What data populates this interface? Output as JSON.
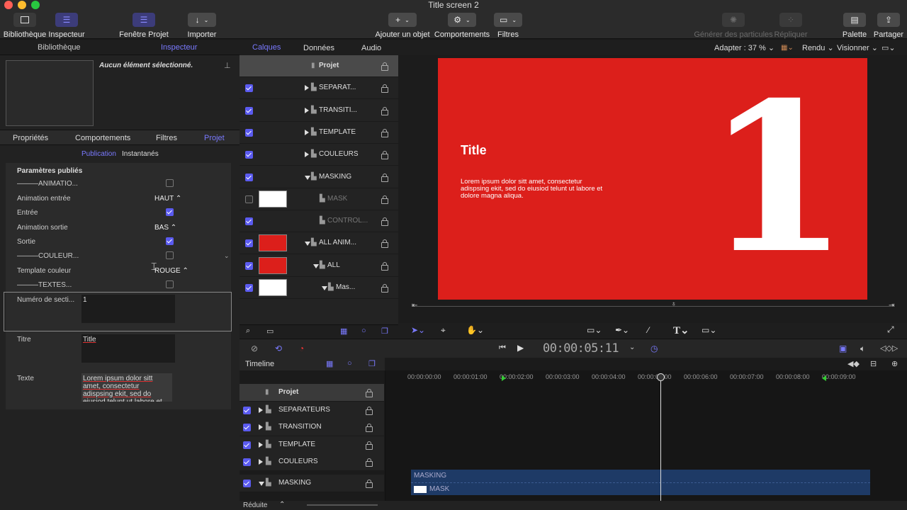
{
  "window": {
    "title": "Title screen 2"
  },
  "toolbar": {
    "library": "Bibliothèque",
    "inspector": "Inspecteur",
    "project_pane": "Fenêtre Projet",
    "import": "Importer",
    "add_object": "Ajouter un objet",
    "behaviors": "Comportements",
    "filters": "Filtres",
    "particles": "Générer des particules",
    "replicate": "Répliquer",
    "palette": "Palette",
    "share": "Partager"
  },
  "left_tabs": {
    "library": "Bibliothèque",
    "inspector": "Inspecteur"
  },
  "preview": {
    "none_selected": "Aucun élément sélectionné."
  },
  "inspector_tabs": [
    "Propriétés",
    "Comportements",
    "Filtres",
    "Projet"
  ],
  "subtabs": {
    "publication": "Publication",
    "snapshots": "Instantanés"
  },
  "params": {
    "header": "Paramètres publiés",
    "rows": [
      {
        "label": "———ANIMATIO...",
        "value": "",
        "checked": false
      },
      {
        "label": "Animation entrée",
        "value": "HAUT ⌃",
        "checked": null
      },
      {
        "label": "Entrée",
        "value": "",
        "checked": true
      },
      {
        "label": "Animation sortie",
        "value": "BAS ⌃",
        "checked": null
      },
      {
        "label": "Sortie",
        "value": "",
        "checked": true
      },
      {
        "label": "———COULEUR...",
        "value": "",
        "checked": false
      },
      {
        "label": "Template couleur",
        "value": "ROUGE ⌃",
        "checked": null
      },
      {
        "label": "———TEXTES...",
        "value": "",
        "checked": false
      }
    ],
    "section_number_label": "Numéro de secti...",
    "section_number_value": "1",
    "title_label": "Titre",
    "title_value": "Title",
    "text_label": "Texte",
    "text_value": "Lorem ipsum dolor sitt amet, consectetur adispsing ekit, sed do eiusiod telunt ut labore et"
  },
  "panel_tabs": {
    "layers": "Calques",
    "data": "Données",
    "audio": "Audio"
  },
  "layers": [
    {
      "name": "Projet",
      "checked": null,
      "indent": 0,
      "tri": "",
      "thumb": ""
    },
    {
      "name": "SEPARAT...",
      "checked": true,
      "indent": 1,
      "tri": "r",
      "thumb": ""
    },
    {
      "name": "TRANSITI...",
      "checked": true,
      "indent": 1,
      "tri": "r",
      "thumb": ""
    },
    {
      "name": "TEMPLATE",
      "checked": true,
      "indent": 1,
      "tri": "r",
      "thumb": ""
    },
    {
      "name": "COULEURS",
      "checked": true,
      "indent": 1,
      "tri": "r",
      "thumb": ""
    },
    {
      "name": "MASKING",
      "checked": true,
      "indent": 1,
      "tri": "d",
      "thumb": ""
    },
    {
      "name": "MASK",
      "checked": false,
      "indent": 2,
      "tri": "",
      "thumb": "white"
    },
    {
      "name": "CONTROL...",
      "checked": true,
      "indent": 2,
      "tri": "",
      "thumb": ""
    },
    {
      "name": "ALL ANIM...",
      "checked": true,
      "indent": 1,
      "tri": "d",
      "thumb": "red"
    },
    {
      "name": "ALL",
      "checked": true,
      "indent": 2,
      "tri": "d",
      "thumb": "red"
    },
    {
      "name": "Mas...",
      "checked": true,
      "indent": 3,
      "tri": "d",
      "thumb": "white"
    }
  ],
  "canvas": {
    "fit": "Adapter : 37 %",
    "render": "Rendu",
    "view": "Visionner",
    "big_number": "1",
    "title": "Title",
    "body": "Lorem ipsum dolor sitt amet, consectetur adispsing ekit, sed do eiusiod telunt ut labore et dolore magna aliqua."
  },
  "colors": {
    "accent": "#5b5bf0",
    "canvas_red": "#dc1f1b",
    "timeline_blue": "#1e3a66"
  },
  "transport": {
    "timecode": "00:00:05:11"
  },
  "timeline": {
    "label": "Timeline",
    "ruler": [
      "00:00:00:00",
      "00:00:01:00",
      "00:00:02:00",
      "00:00:03:00",
      "00:00:04:00",
      "00:00:05:00",
      "00:00:06:00",
      "00:00:07:00",
      "00:00:08:00",
      "00:00:09:00"
    ],
    "rows": [
      {
        "name": "Projet",
        "checked": null,
        "tri": ""
      },
      {
        "name": "SEPARATEURS",
        "checked": true,
        "tri": "r"
      },
      {
        "name": "TRANSITION",
        "checked": true,
        "tri": "r"
      },
      {
        "name": "TEMPLATE",
        "checked": true,
        "tri": "r"
      },
      {
        "name": "COULEURS",
        "checked": true,
        "tri": "r"
      },
      {
        "name": "MASKING",
        "checked": true,
        "tri": "d"
      }
    ],
    "track_masking": "MASKING",
    "track_mask": "MASK"
  },
  "footer": {
    "size": "Réduite"
  }
}
